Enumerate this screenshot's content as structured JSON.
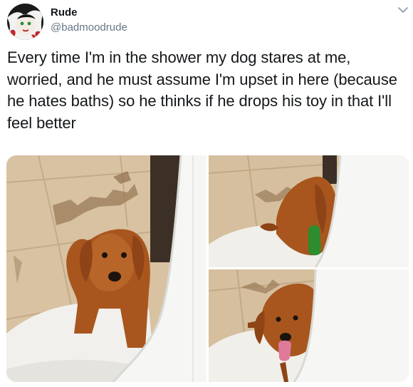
{
  "user": {
    "name": "Rude",
    "handle": "@badmoodrude"
  },
  "icons": {
    "menu": "chevron-down-icon",
    "avatar": "avatar-illustration"
  },
  "tweet": {
    "text": "Every time I'm in the shower my dog stares at me, worried, and he must assume I'm upset in here (because he hates baths) so he thinks if he drops his toy in that I'll feel better"
  },
  "media": {
    "count": 3,
    "photos": [
      "dog-peeking-shower-photo",
      "dog-dropping-toy-photo",
      "dog-holding-toy-photo"
    ]
  },
  "colors": {
    "text": "#14171a",
    "secondary": "#657786",
    "tile": "#d9c4a6",
    "dog": "#a3541e",
    "curtain": "#f7f7f5",
    "toy_green": "#2e8b2e",
    "toy_pink": "#e07a9a"
  }
}
